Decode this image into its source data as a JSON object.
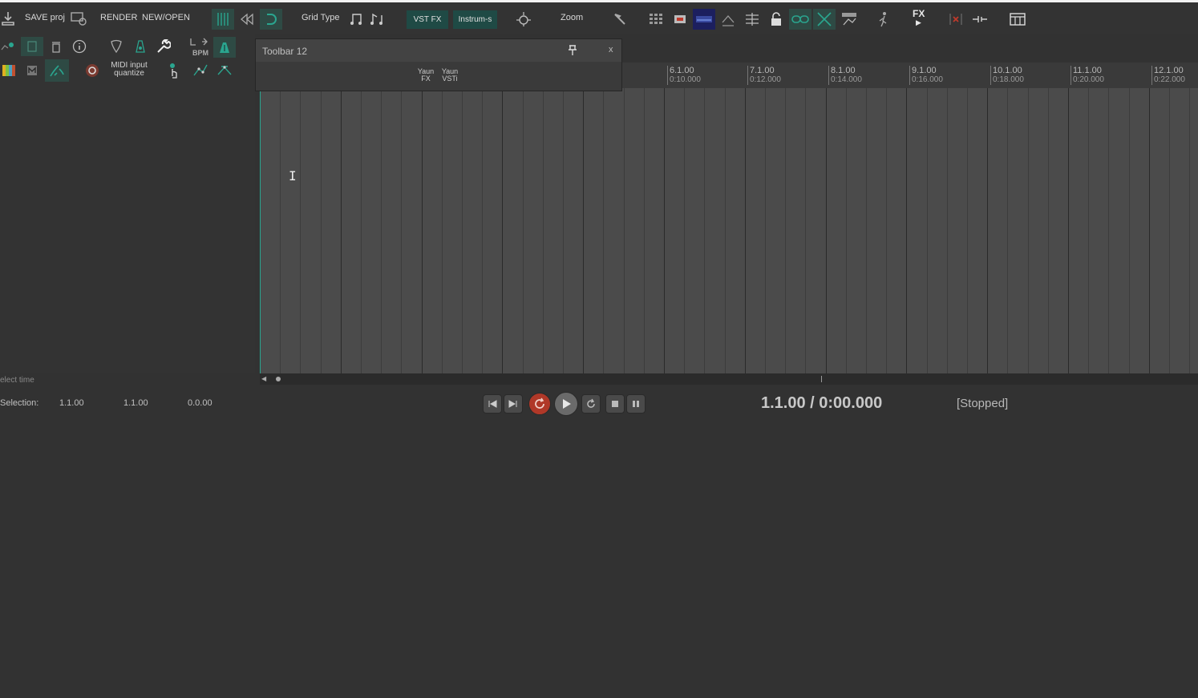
{
  "toolbar": {
    "save_proj": "SAVE proj",
    "render": "RENDER",
    "new_open": "NEW/OPEN",
    "grid_type": "Grid Type",
    "vst_fx": "VST FX",
    "instruments": "Instrum-s",
    "zoom": "Zoom",
    "fx": "FX"
  },
  "toolbar_row2": {
    "bpm": "BPM",
    "midi_input_quantize_line1": "MIDI input",
    "midi_input_quantize_line2": "quantize"
  },
  "floating_toolbar": {
    "title": "Toolbar 12",
    "close": "x",
    "btn1_line1": "Yaun",
    "btn1_line2": "FX",
    "btn2_line1": "Yaun",
    "btn2_line2": "VSTi"
  },
  "ruler": {
    "marks": [
      {
        "bar": "6.1.00",
        "time": "0:10.000"
      },
      {
        "bar": "7.1.00",
        "time": "0:12.000"
      },
      {
        "bar": "8.1.00",
        "time": "0:14.000"
      },
      {
        "bar": "9.1.00",
        "time": "0:16.000"
      },
      {
        "bar": "10.1.00",
        "time": "0:18.000"
      },
      {
        "bar": "11.1.00",
        "time": "0:20.000"
      },
      {
        "bar": "12.1.00",
        "time": "0:22.000"
      }
    ]
  },
  "status": {
    "hint": "elect time",
    "selection_label": "Selection:",
    "sel_start": "1.1.00",
    "sel_end": "1.1.00",
    "sel_length": "0.0.00"
  },
  "transport": {
    "position": "1.1.00 / 0:00.000",
    "state": "[Stopped]"
  },
  "colors": {
    "accent_teal": "#2aa58f",
    "record_red": "#c0392b",
    "background": "#323232",
    "arrange": "#4b4b4b"
  }
}
